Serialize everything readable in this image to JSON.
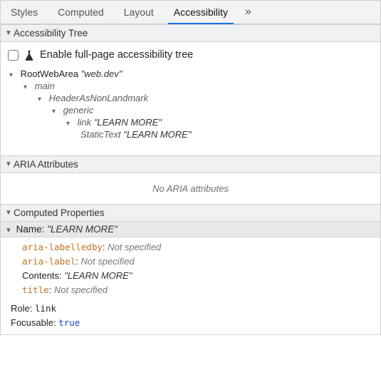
{
  "tabs": {
    "items": [
      "Styles",
      "Computed",
      "Layout",
      "Accessibility"
    ],
    "active_index": 3,
    "overflow_glyph": "»"
  },
  "sections": {
    "tree_header": "Accessibility Tree",
    "aria_header": "ARIA Attributes",
    "computed_header": "Computed Properties"
  },
  "enable_checkbox": {
    "checked": false,
    "label": "Enable full-page accessibility tree"
  },
  "tree": {
    "nodes": [
      {
        "depth": 0,
        "expanded": true,
        "role": "RootWebArea",
        "name": "web.dev",
        "italic_role": false
      },
      {
        "depth": 1,
        "expanded": true,
        "role": "main",
        "name": null,
        "italic_role": true
      },
      {
        "depth": 2,
        "expanded": true,
        "role": "HeaderAsNonLandmark",
        "name": null,
        "italic_role": true
      },
      {
        "depth": 3,
        "expanded": true,
        "role": "generic",
        "name": null,
        "italic_role": true
      },
      {
        "depth": 4,
        "expanded": true,
        "role": "link",
        "name": "LEARN MORE",
        "italic_role": true
      },
      {
        "depth": 5,
        "expanded": null,
        "role": "StaticText",
        "name": "LEARN MORE",
        "italic_role": true
      }
    ]
  },
  "aria_empty_msg": "No ARIA attributes",
  "computed": {
    "name_label": "Name: ",
    "name_value": "\"LEARN MORE\"",
    "sources": [
      {
        "attr": "aria-labelledby",
        "value": "Not specified",
        "spec": false
      },
      {
        "attr": "aria-label",
        "value": "Not specified",
        "spec": false
      },
      {
        "attr": "Contents",
        "value": "\"LEARN MORE\"",
        "spec": true,
        "plain_attr": true
      },
      {
        "attr": "title",
        "value": "Not specified",
        "spec": false
      }
    ],
    "role_label": "Role: ",
    "role_value": "link",
    "focusable_label": "Focusable: ",
    "focusable_value": "true"
  }
}
